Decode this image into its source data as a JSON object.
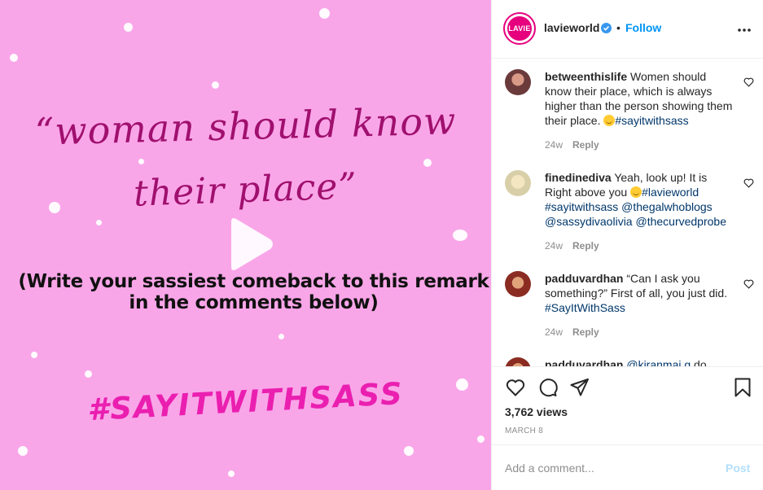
{
  "media": {
    "line1": "“woman should know",
    "line2": "their place”",
    "instruction_line1": "(Write your sassiest comeback to this remark",
    "instruction_line2": "in the comments below)",
    "hashtag": "#SAYITWITHSASS",
    "background_color": "#f9a6e9",
    "script_color": "#a0106e",
    "hashtag_color": "#ea1fb0",
    "play_icon": "play-icon"
  },
  "header": {
    "avatar_text": "LAVIE",
    "username": "lavieworld",
    "separator": "•",
    "follow_label": "Follow",
    "more_icon": "more-horizontal-icon"
  },
  "comments": [
    {
      "username": "betweenthislife",
      "text": "Women should know their place, which is always higher than the person showing them their place.",
      "tags": [
        "#sayitwithsass"
      ],
      "time": "24w",
      "reply": "Reply"
    },
    {
      "username": "finedinediva",
      "text": "Yeah, look up! It is Right above you",
      "tags": [
        "#lavieworld",
        "#sayitwithsass",
        "@thegalwhoblogs",
        "@sassydivaolivia",
        "@thecurvedprobe"
      ],
      "time": "24w",
      "reply": "Reply"
    },
    {
      "username": "padduvardhan",
      "text": "“Can I ask you something?” First of all, you just did.",
      "tags": [
        "#SayItWithSass"
      ],
      "time": "24w",
      "reply": "Reply"
    },
    {
      "username": "padduvardhan",
      "text": "",
      "tags": [
        "@kiranmai.g",
        "do"
      ],
      "time": "",
      "reply": ""
    }
  ],
  "actions": {
    "icons": [
      "heart-icon",
      "comment-icon",
      "share-icon",
      "bookmark-icon"
    ],
    "views": "3,762 views",
    "date": "MARCH 8"
  },
  "add_comment": {
    "placeholder": "Add a comment...",
    "post_label": "Post"
  },
  "colors": {
    "link_blue": "#0095f6",
    "hashtag_link": "#00376b",
    "muted": "#8e8e8e",
    "brand_pink": "#e6007e"
  }
}
